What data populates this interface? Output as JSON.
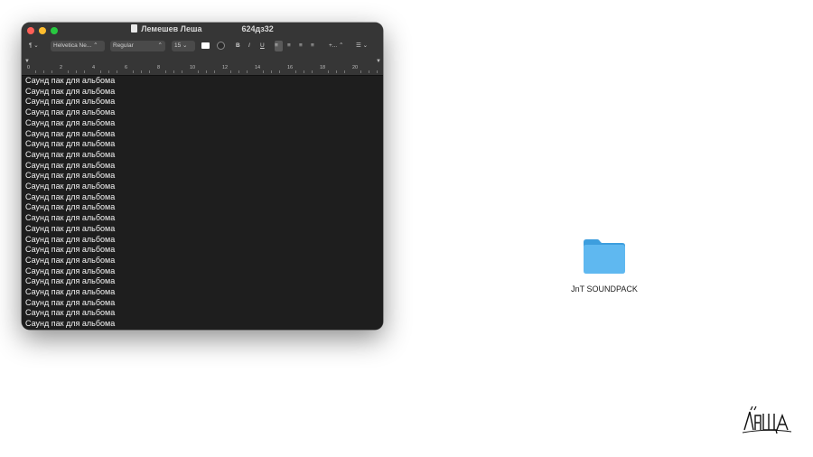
{
  "window": {
    "document_title": "Лемешев Леша",
    "secondary_title": "624дз32",
    "toolbar": {
      "paragraph_label": "¶",
      "font_family": "Helvetica Ne...",
      "font_style": "Regular",
      "font_size": "15",
      "bold": "B",
      "italic": "I",
      "underline": "U",
      "spacing": "+...",
      "list": "☰"
    },
    "ruler": {
      "ticks": [
        "0",
        "2",
        "4",
        "6",
        "8",
        "10",
        "12",
        "14",
        "16",
        "18",
        "20"
      ]
    },
    "content_lines": [
      "Саунд пак для альбома",
      "Саунд пак для альбома",
      "Саунд пак для альбома",
      "Саунд пак для альбома",
      "Саунд пак для альбома",
      "Саунд пак для альбома",
      "Саунд пак для альбома",
      "Саунд пак для альбома",
      "Саунд пак для альбома",
      "Саунд пак для альбома",
      "Саунд пак для альбома",
      "Саунд пак для альбома",
      "Саунд пак для альбома",
      "Саунд пак для альбома",
      "Саунд пак для альбома",
      "Саунд пак для альбома",
      "Саунд пак для альбома",
      "Саунд пак для альбома",
      "Саунд пак для альбома",
      "Саунд пак для альбома",
      "Саунд пак для альбома",
      "Саунд пак для альбома",
      "Саунд пак для альбома",
      "Саунд пак для альбома",
      "Саунд пак для альбома"
    ]
  },
  "desktop": {
    "folder": {
      "label": "JnT SOUNDPACK",
      "icon": "folder-icon",
      "color": "#5fb8f0"
    },
    "signature": {
      "text": "Леша",
      "icon": "signature-logo"
    }
  },
  "colors": {
    "close": "#fe5f57",
    "minimize": "#febc2e",
    "maximize": "#28c840",
    "editor_background": "#1e1e1e",
    "toolbar_background": "#363636"
  }
}
